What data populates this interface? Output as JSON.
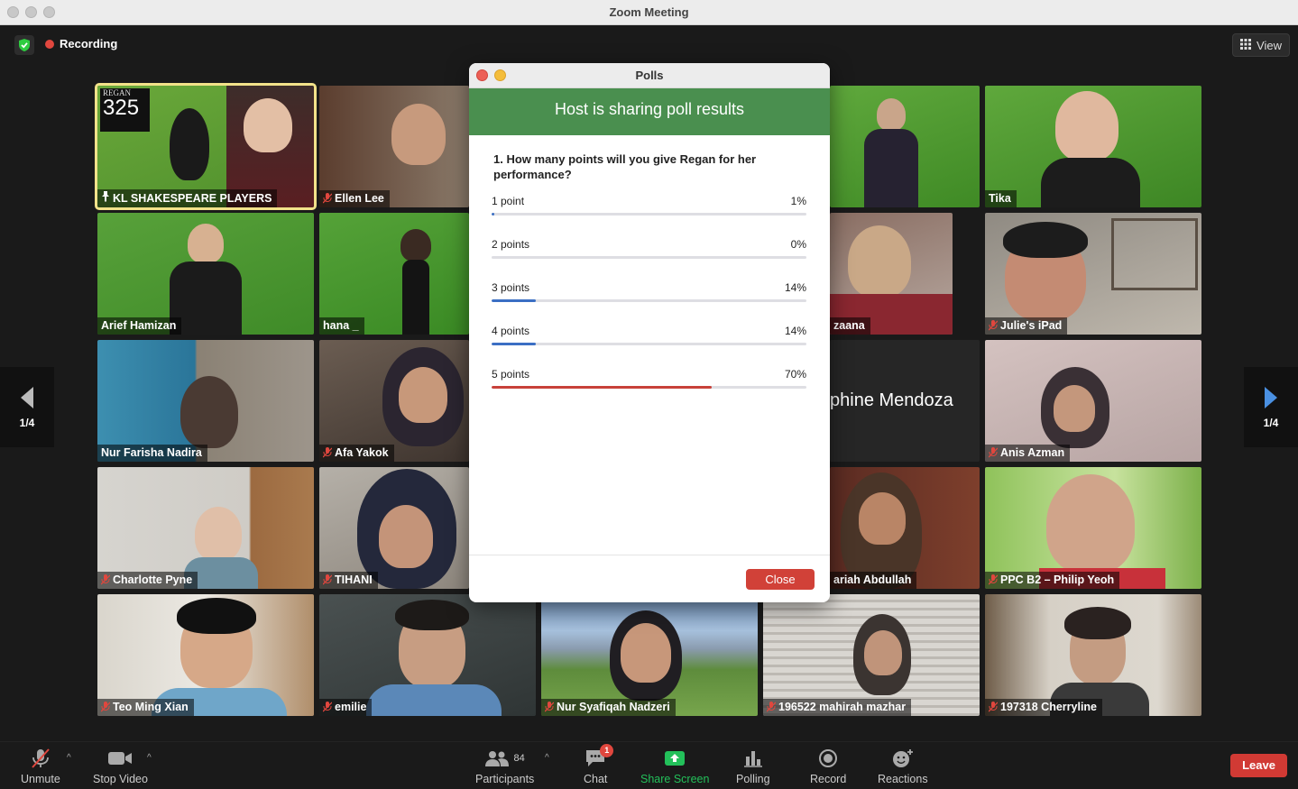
{
  "window": {
    "title": "Zoom Meeting"
  },
  "meeting": {
    "recording_label": "Recording",
    "view_label": "View"
  },
  "gallery": {
    "page_indicator_left": "1/4",
    "page_indicator_right": "1/4",
    "tiles": [
      {
        "name": "KL SHAKESPEARE PLAYERS",
        "overlay_top": "REGAN",
        "overlay_score": "325"
      },
      {
        "name": "Ellen Lee"
      },
      {
        "name": "Tika"
      },
      {
        "name": "Arief Hamizan"
      },
      {
        "name": "hana _"
      },
      {
        "name": "zaana"
      },
      {
        "name": "Julie's iPad"
      },
      {
        "name": "Nur Farisha Nadira"
      },
      {
        "name": "Afa Yakok"
      },
      {
        "name": "phine Mendoza"
      },
      {
        "name": "Anis Azman"
      },
      {
        "name": "Charlotte Pyne"
      },
      {
        "name": "TIHANI"
      },
      {
        "name": "ariah Abdullah"
      },
      {
        "name": "PPC B2 – Philip Yeoh"
      },
      {
        "name": "Teo Ming Xian"
      },
      {
        "name": "emilie"
      },
      {
        "name": "Nur Syafiqah Nadzeri"
      },
      {
        "name": "196522 mahirah mazhar"
      },
      {
        "name": "197318 Cherryline"
      }
    ]
  },
  "poll": {
    "window_title": "Polls",
    "banner": "Host is sharing poll results",
    "question": "1. How many points will you give Regan for her performance?",
    "options": [
      {
        "label": "1 point",
        "percent_text": "1%",
        "percent": 1,
        "color": "#3b6fc4"
      },
      {
        "label": "2 points",
        "percent_text": "0%",
        "percent": 0,
        "color": "#3b6fc4"
      },
      {
        "label": "3 points",
        "percent_text": "14%",
        "percent": 14,
        "color": "#3b6fc4"
      },
      {
        "label": "4 points",
        "percent_text": "14%",
        "percent": 14,
        "color": "#3b6fc4"
      },
      {
        "label": "5 points",
        "percent_text": "70%",
        "percent": 70,
        "color": "#c8413a"
      }
    ],
    "close_label": "Close"
  },
  "toolbar": {
    "unmute": "Unmute",
    "stop_video": "Stop Video",
    "participants": "Participants",
    "participant_count": "84",
    "chat": "Chat",
    "chat_badge": "1",
    "share_screen": "Share Screen",
    "polling": "Polling",
    "record": "Record",
    "reactions": "Reactions",
    "leave": "Leave"
  },
  "colors": {
    "accent_green": "#4a8f4f",
    "share_green": "#23c05a",
    "leave_red": "#d13a34",
    "recording_red": "#e0473e",
    "active_speaker": "#f2e28a"
  }
}
